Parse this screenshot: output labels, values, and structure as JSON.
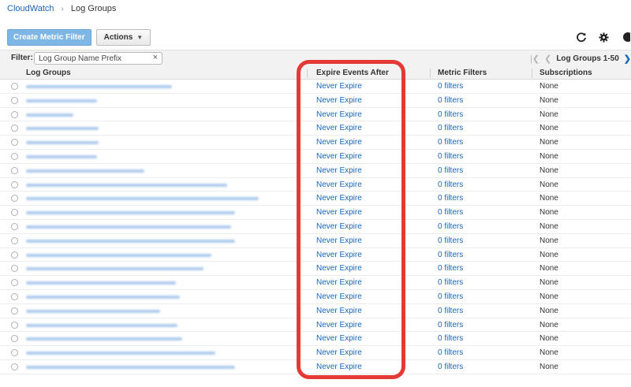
{
  "breadcrumb": {
    "root": "CloudWatch",
    "current": "Log Groups"
  },
  "toolbar": {
    "create_metric_filter": "Create Metric Filter",
    "actions": "Actions"
  },
  "icons": {
    "refresh": "refresh-icon",
    "settings": "gear-icon",
    "help": "help-icon"
  },
  "filter": {
    "label": "Filter:",
    "placeholder": "Log Group Name Prefix",
    "value": ""
  },
  "pager": {
    "label": "Log Groups 1-50"
  },
  "table": {
    "columns": [
      "Log Groups",
      "Expire Events After",
      "Metric Filters",
      "Subscriptions"
    ],
    "rows": [
      {
        "expire": "Never Expire",
        "filters": "0 filters",
        "subs": "None"
      },
      {
        "expire": "Never Expire",
        "filters": "0 filters",
        "subs": "None"
      },
      {
        "expire": "Never Expire",
        "filters": "0 filters",
        "subs": "None"
      },
      {
        "expire": "Never Expire",
        "filters": "0 filters",
        "subs": "None"
      },
      {
        "expire": "Never Expire",
        "filters": "0 filters",
        "subs": "None"
      },
      {
        "expire": "Never Expire",
        "filters": "0 filters",
        "subs": "None"
      },
      {
        "expire": "Never Expire",
        "filters": "0 filters",
        "subs": "None"
      },
      {
        "expire": "Never Expire",
        "filters": "0 filters",
        "subs": "None"
      },
      {
        "expire": "Never Expire",
        "filters": "0 filters",
        "subs": "None"
      },
      {
        "expire": "Never Expire",
        "filters": "0 filters",
        "subs": "None"
      },
      {
        "expire": "Never Expire",
        "filters": "0 filters",
        "subs": "None"
      },
      {
        "expire": "Never Expire",
        "filters": "0 filters",
        "subs": "None"
      },
      {
        "expire": "Never Expire",
        "filters": "0 filters",
        "subs": "None"
      },
      {
        "expire": "Never Expire",
        "filters": "0 filters",
        "subs": "None"
      },
      {
        "expire": "Never Expire",
        "filters": "0 filters",
        "subs": "None"
      },
      {
        "expire": "Never Expire",
        "filters": "0 filters",
        "subs": "None"
      },
      {
        "expire": "Never Expire",
        "filters": "0 filters",
        "subs": "None"
      },
      {
        "expire": "Never Expire",
        "filters": "0 filters",
        "subs": "None"
      },
      {
        "expire": "Never Expire",
        "filters": "0 filters",
        "subs": "None"
      },
      {
        "expire": "Never Expire",
        "filters": "0 filters",
        "subs": "None"
      },
      {
        "expire": "Never Expire",
        "filters": "0 filters",
        "subs": "None"
      }
    ]
  },
  "colors": {
    "link": "#1a66b7",
    "primary_button": "#7eb6e6",
    "annotation": "#e53935"
  }
}
